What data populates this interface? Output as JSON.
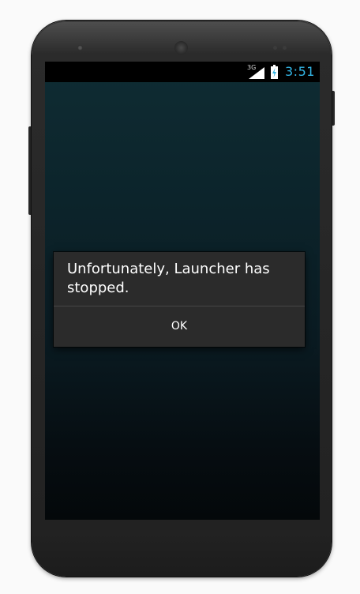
{
  "status_bar": {
    "network_type": "3G",
    "time": "3:51",
    "clock_color": "#33b5e5",
    "icons": [
      "signal-icon",
      "battery-charging-icon"
    ]
  },
  "dialog": {
    "message": "Unfortunately, Launcher has stopped.",
    "ok_label": "OK"
  },
  "device": {
    "body_color": "#262626"
  }
}
